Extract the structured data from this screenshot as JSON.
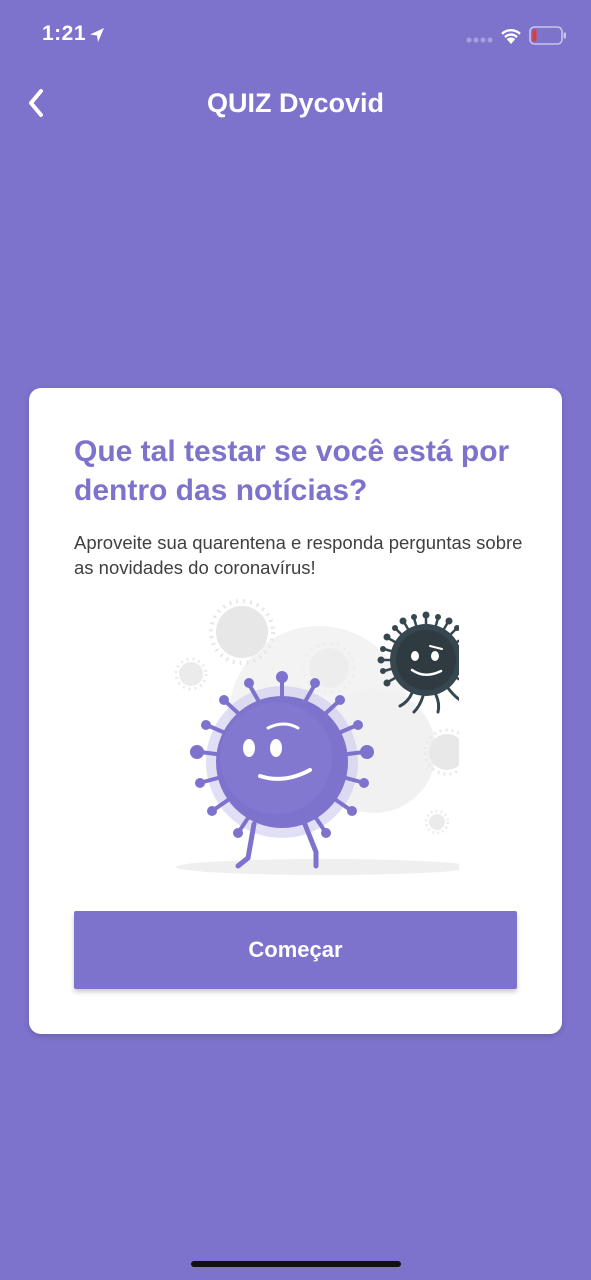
{
  "status_bar": {
    "time": "1:21",
    "icons": [
      "location-arrow-icon",
      "signal-icon",
      "wifi-icon",
      "battery-low-icon"
    ]
  },
  "nav": {
    "title": "QUIZ Dycovid",
    "back_icon": "chevron-left-icon"
  },
  "card": {
    "heading": "Que tal testar se você está por dentro das notícias?",
    "subtitle": "Aproveite sua quarentena e responda perguntas sobre as novidades do coronavírus!",
    "illustration": "cartoon-virus-characters",
    "button_label": "Começar"
  },
  "colors": {
    "background": "#7D72CC",
    "accent": "#7D72CC",
    "card": "#FFFFFF",
    "text_dark": "#404040",
    "virus_dark": "#37474F",
    "battery_low": "#E53935"
  }
}
